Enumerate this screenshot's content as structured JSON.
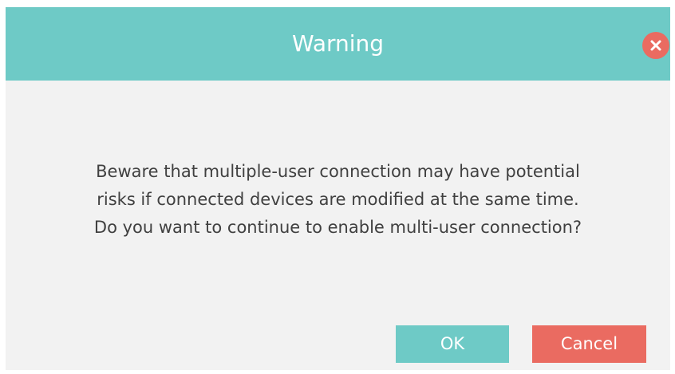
{
  "dialog": {
    "title": "Warning",
    "close_icon": "close-icon",
    "message_lines": [
      "Beware that multiple-user connection may have potential",
      "risks if connected devices are modified at the same time.",
      "Do you want to continue to enable multi-user connection?"
    ],
    "buttons": {
      "ok_label": "OK",
      "cancel_label": "Cancel"
    }
  },
  "colors": {
    "header": "#6ecac6",
    "ok_button": "#6ecac6",
    "cancel_button": "#ea6b61",
    "close_button": "#ea6b61",
    "body_background": "#f2f2f2",
    "text": "#404040"
  }
}
